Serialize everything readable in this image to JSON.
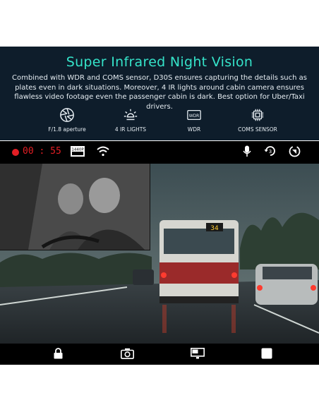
{
  "header": {
    "title": "Super Infrared Night Vision",
    "description": "Combined with WDR and COMS sensor, D30S ensures capturing the details such as plates even in dark situations. Moreover, 4 IR  lights around cabin camera ensures flawless video footage even the passenger cabin is dark. Best option for Uber/Taxi drivers.",
    "title_color": "#35e3c9",
    "background_color": "#0e1d2b"
  },
  "features": [
    {
      "icon": "aperture-icon",
      "label": "F/1.8 aperture"
    },
    {
      "icon": "ir-light-icon",
      "label": "4 IR LIGHTS"
    },
    {
      "icon": "wdr-icon",
      "label": "WDR"
    },
    {
      "icon": "cmos-chip-icon",
      "label": "COMS SENSOR"
    }
  ],
  "screen": {
    "rec_time": "00 : 55",
    "rec_color": "#e31e24",
    "resolution_badge": "1440P",
    "rear_plate": "34",
    "top_icons": [
      "resolution-icon",
      "wifi-icon",
      "microphone-icon",
      "loop-recording-icon",
      "rotate-icon"
    ],
    "bottom_icons": [
      "lock-icon",
      "camera-icon",
      "picture-in-picture-icon",
      "stop-icon"
    ]
  }
}
